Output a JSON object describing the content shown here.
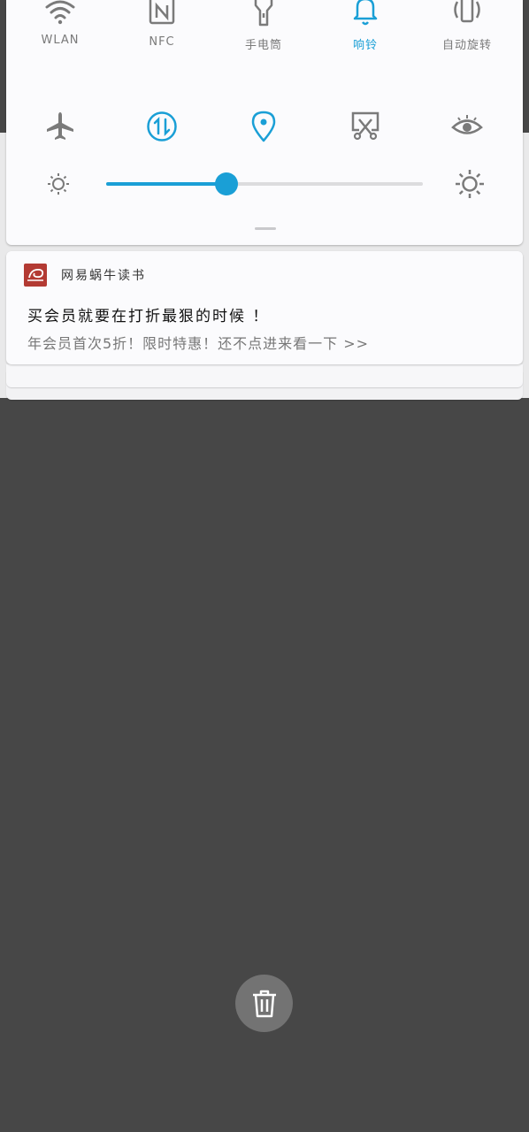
{
  "quick_settings": {
    "tiles_row1": [
      {
        "label": "WLAN",
        "icon": "wifi-icon",
        "active": false
      },
      {
        "label": "NFC",
        "icon": "nfc-icon",
        "active": false
      },
      {
        "label": "手电筒",
        "icon": "flashlight-icon",
        "active": false
      },
      {
        "label": "响铃",
        "icon": "bell-icon",
        "active": true
      },
      {
        "label": "自动旋转",
        "icon": "auto-rotate-icon",
        "active": false
      }
    ],
    "tiles_row2": [
      {
        "icon": "airplane-mode-icon",
        "active": false
      },
      {
        "icon": "mobile-data-icon",
        "active": true
      },
      {
        "icon": "location-icon",
        "active": true
      },
      {
        "icon": "screen-cast-icon",
        "active": false
      },
      {
        "icon": "eye-comfort-icon",
        "active": false
      }
    ],
    "brightness": {
      "level": 0.38,
      "icon_low": "brightness-low-icon",
      "icon_high": "brightness-high-icon"
    },
    "accent_color": "#1a9fd6"
  },
  "notification": {
    "app_name": "网易蜗牛读书",
    "app_icon": "netease-snail-reading-icon",
    "title": "买会员就要在打折最狠的时候 ！",
    "body": "年会员首次5折！限时特惠！还不点进来看一下 >>"
  },
  "clear_button": {
    "icon": "trash-icon"
  }
}
